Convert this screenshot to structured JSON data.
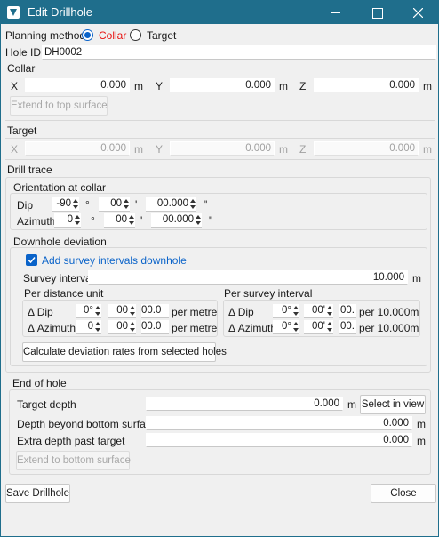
{
  "window": {
    "title": "Edit Drillhole"
  },
  "planning": {
    "label": "Planning method",
    "options": [
      "Collar",
      "Target"
    ],
    "selected": "Collar"
  },
  "hole_id": {
    "label": "Hole ID",
    "value": "DH0002"
  },
  "collar": {
    "title": "Collar",
    "x_label": "X",
    "x": "0.000",
    "y_label": "Y",
    "y": "0.000",
    "z_label": "Z",
    "z": "0.000",
    "unit": "m",
    "extend_button": "Extend to top surface"
  },
  "target": {
    "title": "Target",
    "x_label": "X",
    "x": "0.000",
    "y_label": "Y",
    "y": "0.000",
    "z_label": "Z",
    "z": "0.000",
    "unit": "m"
  },
  "drill_trace": {
    "title": "Drill trace",
    "orientation": {
      "title": "Orientation at collar",
      "dip_label": "Dip",
      "dip_deg": "-90",
      "dip_min": "00",
      "dip_sec": "00.000",
      "azimuth_label": "Azimuth",
      "az_deg": "0",
      "az_min": "00",
      "az_sec": "00.000",
      "deg_sym": "°",
      "min_sym": "'",
      "sec_sym": "\""
    },
    "deviation": {
      "title": "Downhole deviation",
      "add_intervals_label": "Add survey intervals downhole",
      "add_intervals_checked": true,
      "survey_interval_label": "Survey interval",
      "survey_interval": "10.000",
      "unit": "m",
      "per_distance": {
        "title": "Per distance unit",
        "dip_label": "Δ Dip",
        "dip": [
          "0°",
          "00",
          "00.0"
        ],
        "az_label": "Δ Azimuth",
        "az": [
          "0",
          "00",
          "00.0"
        ],
        "suffix": "per metre"
      },
      "per_survey": {
        "title": "Per survey interval",
        "dip_label": "Δ Dip",
        "dip": [
          "0°",
          "00'",
          "00."
        ],
        "az_label": "Δ Azimuth",
        "az": [
          "0°",
          "00'",
          "00."
        ],
        "suffix": "per 10.000m"
      },
      "calc_button": "Calculate deviation rates from selected holes"
    }
  },
  "end_of_hole": {
    "title": "End of hole",
    "target_depth_label": "Target depth",
    "target_depth": "0.000",
    "select_in_view": "Select in view",
    "depth_beyond_label": "Depth beyond bottom surface",
    "depth_beyond": "0.000",
    "extra_depth_label": "Extra depth past target",
    "extra_depth": "0.000",
    "unit": "m",
    "extend_button": "Extend to bottom surface"
  },
  "footer": {
    "save": "Save Drillhole",
    "close": "Close"
  },
  "colors": {
    "titlebar": "#1f6e8c",
    "accent": "#0a63c9",
    "collar_text": "#e8110f"
  }
}
